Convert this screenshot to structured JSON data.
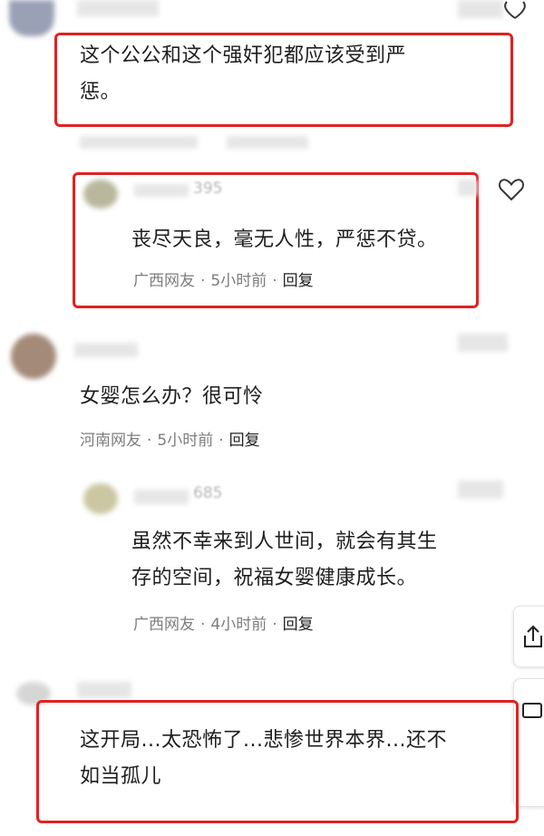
{
  "comments": [
    {
      "text_line1": "这个公公和这个强奸犯都应该受到严",
      "text_line2": "惩。"
    },
    {
      "username_fragment": "395",
      "text": "丧尽天良，毫无人性，严惩不贷。",
      "location": "广西网友",
      "time": "5小时前",
      "reply": "回复"
    },
    {
      "text": "女婴怎么办？很可怜",
      "location": "河南网友",
      "time": "5小时前",
      "reply": "回复"
    },
    {
      "username_fragment": "685",
      "text_line1": "虽然不幸来到人世间，就会有其生",
      "text_line2": "存的空间，祝福女婴健康成长。",
      "location": "广西网友",
      "time": "4小时前",
      "reply": "回复"
    },
    {
      "text_line1": "这开局...太恐怖了...悲惨世界本界...还不",
      "text_line2": "如当孤儿"
    }
  ],
  "separator": "·"
}
